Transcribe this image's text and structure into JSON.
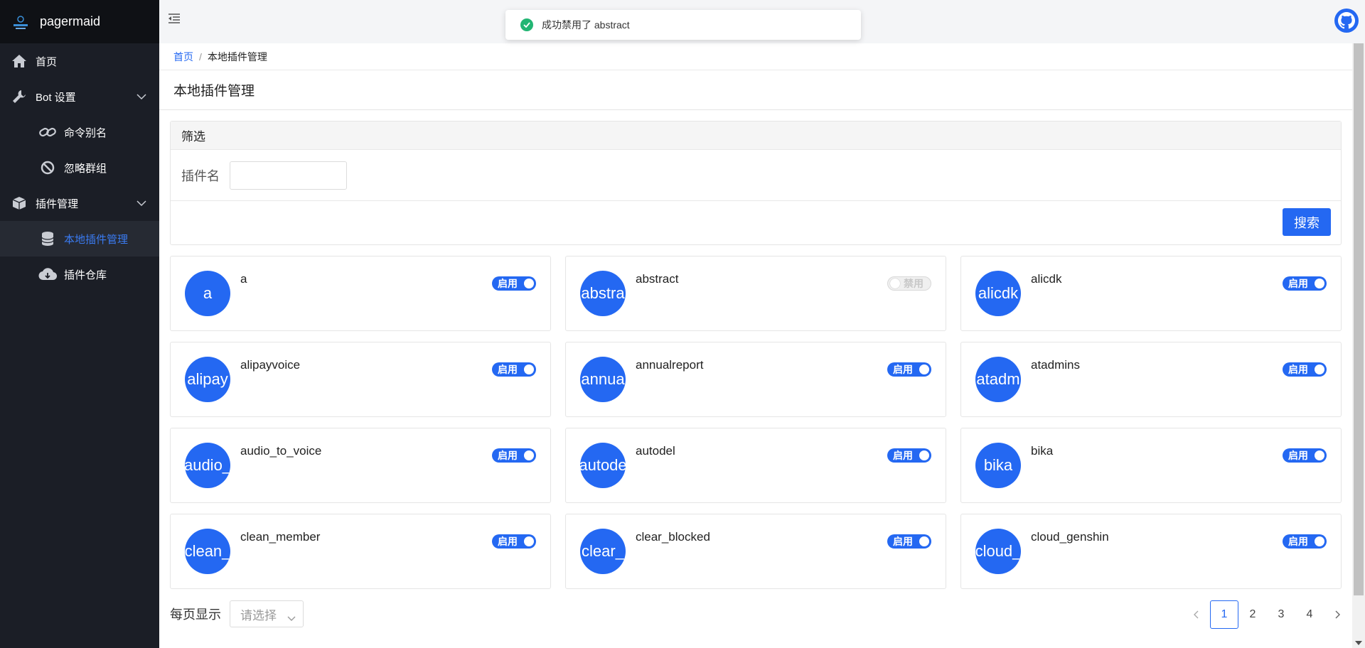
{
  "brand": {
    "name": "pagermaid"
  },
  "sidebar": {
    "items": [
      {
        "label": "首页",
        "icon": "home-icon"
      },
      {
        "label": "Bot 设置",
        "icon": "wrench-icon"
      },
      {
        "label": "命令别名",
        "icon": "link-icon"
      },
      {
        "label": "忽略群组",
        "icon": "ban-icon"
      },
      {
        "label": "插件管理",
        "icon": "box-icon"
      },
      {
        "label": "本地插件管理",
        "icon": "database-icon",
        "active": true
      },
      {
        "label": "插件仓库",
        "icon": "cloud-download-icon"
      }
    ]
  },
  "toast": {
    "message": "成功禁用了 abstract"
  },
  "breadcrumb": {
    "home": "首页",
    "current": "本地插件管理"
  },
  "page": {
    "title": "本地插件管理"
  },
  "filter": {
    "title": "筛选",
    "name_label": "插件名",
    "name_value": "",
    "search_label": "搜索"
  },
  "plugins": [
    {
      "avatar": "a",
      "name": "a",
      "toggle": "启用",
      "enabled": true
    },
    {
      "avatar": "abstra",
      "name": "abstract",
      "toggle": "禁用",
      "enabled": false
    },
    {
      "avatar": "alicdk",
      "name": "alicdk",
      "toggle": "启用",
      "enabled": true
    },
    {
      "avatar": "alipay",
      "name": "alipayvoice",
      "toggle": "启用",
      "enabled": true
    },
    {
      "avatar": "annua",
      "name": "annualreport",
      "toggle": "启用",
      "enabled": true
    },
    {
      "avatar": "atadm",
      "name": "atadmins",
      "toggle": "启用",
      "enabled": true
    },
    {
      "avatar": "audio_",
      "name": "audio_to_voice",
      "toggle": "启用",
      "enabled": true
    },
    {
      "avatar": "autode",
      "name": "autodel",
      "toggle": "启用",
      "enabled": true
    },
    {
      "avatar": "bika",
      "name": "bika",
      "toggle": "启用",
      "enabled": true
    },
    {
      "avatar": "clean_",
      "name": "clean_member",
      "toggle": "启用",
      "enabled": true
    },
    {
      "avatar": "clear_",
      "name": "clear_blocked",
      "toggle": "启用",
      "enabled": true
    },
    {
      "avatar": "cloud_",
      "name": "cloud_genshin",
      "toggle": "启用",
      "enabled": true
    }
  ],
  "pagination": {
    "page_size_label": "每页显示",
    "page_size_placeholder": "请选择",
    "pages": [
      "1",
      "2",
      "3",
      "4"
    ],
    "current": "1"
  },
  "colors": {
    "accent": "#2468f2",
    "sidebar_bg": "#1b1e26",
    "success": "#22b573"
  }
}
